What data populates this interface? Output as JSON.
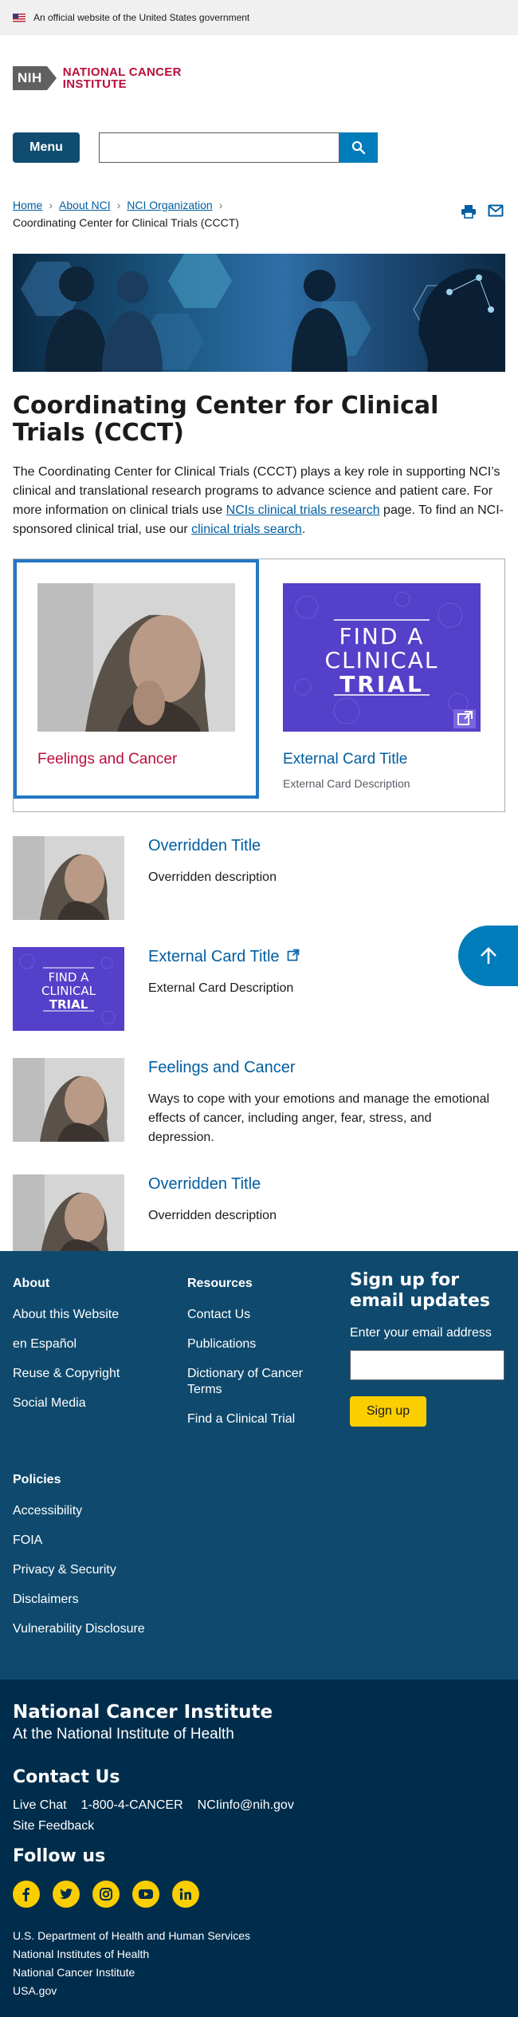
{
  "banner": {
    "text": "An official website of the United States government"
  },
  "logo": {
    "nih": "NIH",
    "line1": "NATIONAL CANCER",
    "line2": "INSTITUTE"
  },
  "header": {
    "menu_label": "Menu",
    "search_placeholder": ""
  },
  "breadcrumb": {
    "items": [
      "Home",
      "About NCI",
      "NCI Organization"
    ],
    "current": "Coordinating Center for Clinical Trials (CCCT)"
  },
  "page": {
    "title": "Coordinating Center for Clinical Trials (CCCT)",
    "intro_text": "The Coordinating Center for Clinical Trials (CCCT) plays a key role in supporting NCI’s clinical and translational research programs to advance science and patient care. For more information on clinical trials use ",
    "intro_link1": "NCIs clinical trials research",
    "intro_mid": " page. To find an NCI-sponsored clinical trial, use our ",
    "intro_link2": "clinical trials search",
    "intro_end": "."
  },
  "cards": [
    {
      "title": "Feelings and Cancer",
      "description": ""
    },
    {
      "title": "External Card Title",
      "description": "External Card Description",
      "image_text": [
        "FIND A",
        "CLINICAL",
        "TRIAL"
      ]
    }
  ],
  "list": [
    {
      "title": "Overridden Title",
      "description": "Overridden description"
    },
    {
      "title": "External Card Title",
      "description": "External Card Description",
      "image_text": [
        "FIND A",
        "CLINICAL",
        "TRIAL"
      ]
    },
    {
      "title": "Feelings and Cancer",
      "description": "Ways to cope with your emotions and manage the emotional effects of cancer, including anger, fear, stress, and depression."
    },
    {
      "title": "Overridden Title",
      "description": "Overridden description"
    }
  ],
  "footer": {
    "about": {
      "heading": "About",
      "links": [
        "About this Website",
        "en Español",
        "Reuse & Copyright",
        "Social Media"
      ]
    },
    "resources": {
      "heading": "Resources",
      "links": [
        "Contact Us",
        "Publications",
        "Dictionary of Cancer Terms",
        "Find a Clinical Trial"
      ]
    },
    "policies": {
      "heading": "Policies",
      "links": [
        "Accessibility",
        "FOIA",
        "Privacy & Security",
        "Disclaimers",
        "Vulnerability Disclosure"
      ]
    },
    "signup": {
      "title": "Sign up for email updates",
      "label": "Enter your email address",
      "button": "Sign up"
    },
    "org_name": "National Cancer Institute",
    "org_sub": "At the National Institute of Health",
    "contact_title": "Contact Us",
    "contact_items": [
      "Live Chat",
      "1-800-4-CANCER",
      "NCIinfo@nih.gov"
    ],
    "site_feedback": "Site Feedback",
    "follow_title": "Follow us",
    "socials": [
      "facebook-icon",
      "twitter-icon",
      "instagram-icon",
      "youtube-icon",
      "linkedin-icon"
    ],
    "gov_links": [
      "U.S. Department of Health and Human Services",
      "National Institutes of Health",
      "National Cancer Institute",
      "USA.gov"
    ]
  },
  "colors": {
    "brand_red": "#bb0e3d",
    "link_blue": "#005ea2",
    "footer_dark": "#002d4c",
    "footer_mid": "#0f4a6e",
    "signup_yellow": "#face00"
  }
}
